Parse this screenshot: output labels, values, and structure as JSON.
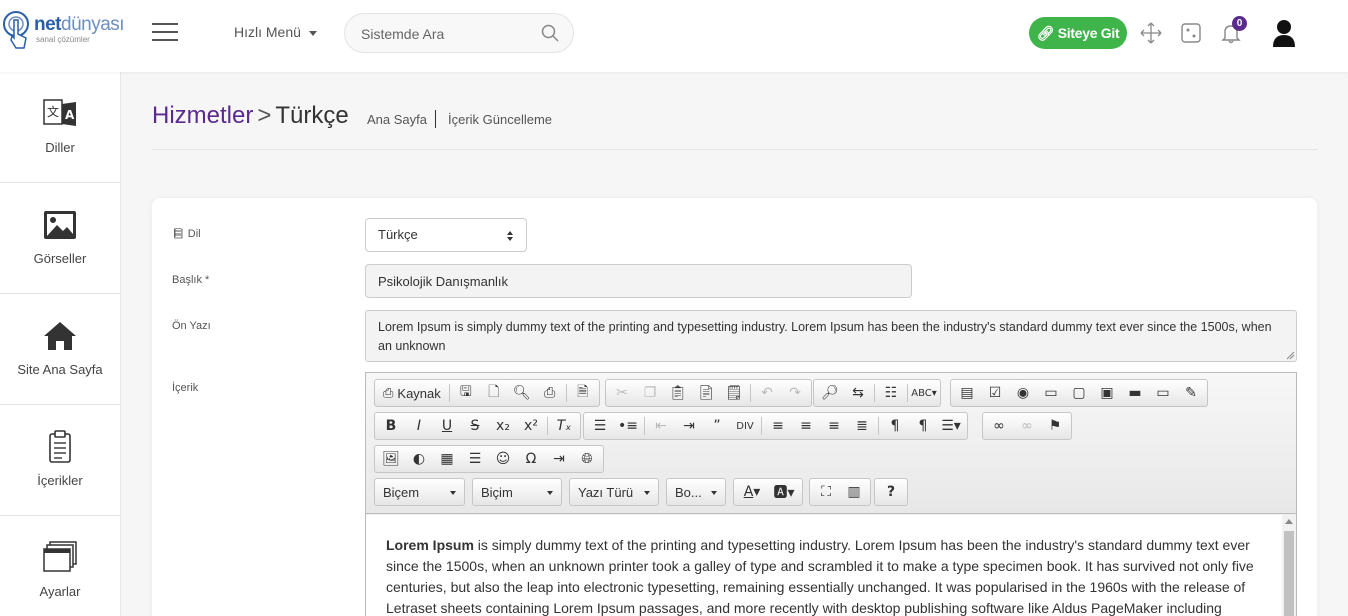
{
  "header": {
    "logo_brand_bold": "net",
    "logo_brand_light": "dünyası",
    "logo_tagline": "sanal çözümler",
    "quick_menu": "Hızlı Menü",
    "search_placeholder": "Sistemde Ara",
    "site_button": "Siteye Git",
    "notification_count": "0",
    "accent_color": "#5b2a8e",
    "button_color": "#3fb44a"
  },
  "sidebar": {
    "items": [
      {
        "label": "Diller",
        "icon": "translate-icon"
      },
      {
        "label": "Görseller",
        "icon": "image-icon"
      },
      {
        "label": "Site Ana Sayfa",
        "icon": "home-icon"
      },
      {
        "label": "İçerikler",
        "icon": "clipboard-icon"
      },
      {
        "label": "Ayarlar",
        "icon": "windows-icon"
      }
    ]
  },
  "page": {
    "title_section": "Hizmetler",
    "title_separator": ">",
    "title_language": "Türkçe",
    "breadcrumb_home": "Ana Sayfa",
    "breadcrumb_current": "İçerik Güncelleme"
  },
  "form": {
    "language_label": "Dil",
    "language_value": "Türkçe",
    "title_label": "Başlık *",
    "title_value": "Psikolojik Danışmanlık",
    "summary_label": "Ön Yazı",
    "summary_value": "Lorem Ipsum is simply dummy text of the printing and typesetting industry. Lorem Ipsum has been the industry's standard dummy text ever since the 1500s, when an unknown",
    "content_label": "İçerik"
  },
  "editor": {
    "source_label": "Kaynak",
    "styles_combo": "Biçem",
    "format_combo": "Biçim",
    "font_combo": "Yazı Türü",
    "size_combo": "Bo...",
    "help_label": "?",
    "content_bold": "Lorem Ipsum",
    "content_text": " is simply dummy text of the printing and typesetting industry. Lorem Ipsum has been the industry's standard dummy text ever since the 1500s, when an unknown printer took a galley of type and scrambled it to make a type specimen book. It has survived not only five centuries, but also the leap into electronic typesetting, remaining essentially unchanged. It was popularised in the 1960s with the release of Letraset sheets containing Lorem Ipsum passages, and more recently with desktop publishing software like Aldus PageMaker including"
  }
}
